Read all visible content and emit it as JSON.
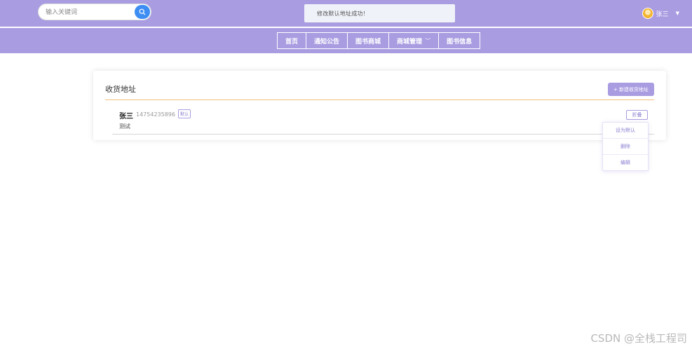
{
  "header": {
    "search": {
      "placeholder": "输入关键词",
      "value": ""
    },
    "toast": "修改默认地址成功！",
    "user": {
      "name": "张三"
    }
  },
  "nav": {
    "items": [
      {
        "label": "首页"
      },
      {
        "label": "通知公告"
      },
      {
        "label": "图书商城"
      },
      {
        "label": "商城管理"
      },
      {
        "label": "图书信息"
      }
    ]
  },
  "address_card": {
    "title": "收货地址",
    "add_button": "+ 新建收货地址",
    "entry": {
      "name": "张三",
      "phone": "14754235896",
      "badge": "默认",
      "detail": "测试",
      "fold_button": "折叠"
    },
    "menu": [
      {
        "label": "设为默认"
      },
      {
        "label": "删除"
      },
      {
        "label": "编辑"
      }
    ]
  },
  "watermark": "CSDN @全栈工程司",
  "colors": {
    "brand": "#a99ce1",
    "search_button": "#3d8df3",
    "divider_accent": "#f2c07a"
  }
}
